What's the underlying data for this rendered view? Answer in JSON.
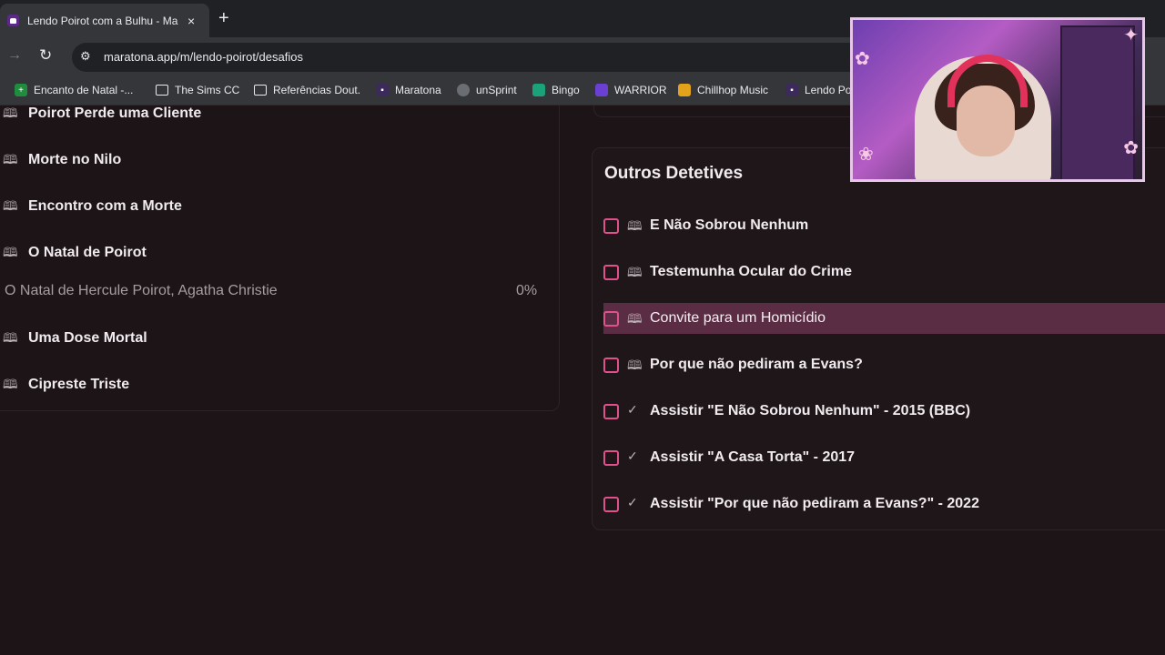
{
  "browser": {
    "tab": {
      "title": "Lendo Poirot com a Bulhu - Ma",
      "close_icon": "×"
    },
    "new_tab_icon": "+",
    "forward_icon": "→",
    "reload_icon": "↻",
    "site_info_icon": "⚙",
    "url": "maratona.app/m/lendo-poirot/desafios"
  },
  "bookmarks": [
    {
      "label": "Encanto de Natal -...",
      "icon": "green-plus-icon"
    },
    {
      "label": "The Sims CC",
      "icon": "folder-icon"
    },
    {
      "label": "Referências Dout.",
      "icon": "folder-icon"
    },
    {
      "label": "Maratona",
      "icon": "maratona-icon"
    },
    {
      "label": "unSprint",
      "icon": "globe-icon"
    },
    {
      "label": "Bingo",
      "icon": "bingo-icon"
    },
    {
      "label": "WARRIOR",
      "icon": "warrior-icon"
    },
    {
      "label": "Chillhop Music",
      "icon": "chillhop-icon"
    },
    {
      "label": "Lendo Po",
      "icon": "maratona-icon"
    }
  ],
  "left_list": {
    "items": [
      "Poirot Perde uma Cliente",
      "Morte no Nilo",
      "Encontro com a Morte",
      "O Natal de Poirot",
      "Uma Dose Mortal",
      "Cipreste Triste"
    ],
    "progress_book": "O Natal de Hercule Poirot, Agatha Christie",
    "progress_percent": "0%"
  },
  "right_section": {
    "title": "Outros Detetives",
    "tasks": [
      {
        "label": "E Não Sobrou Nenhum",
        "icon": "book"
      },
      {
        "label": "Testemunha Ocular do Crime",
        "icon": "book"
      },
      {
        "label": "Convite para um Homicídio",
        "icon": "book"
      },
      {
        "label": "Por que não pediram a Evans?",
        "icon": "book"
      },
      {
        "label": "Assistir \"E Não Sobrou Nenhum\" - 2015 (BBC)",
        "icon": "check"
      },
      {
        "label": "Assistir \"A Casa Torta\" - 2017",
        "icon": "check"
      },
      {
        "label": "Assistir \"Por que não pediram a Evans?\" - 2022",
        "icon": "check"
      }
    ]
  },
  "colors": {
    "background": "#1d1418",
    "accent": "#e0508a",
    "highlight_row": "#5b2d44"
  }
}
